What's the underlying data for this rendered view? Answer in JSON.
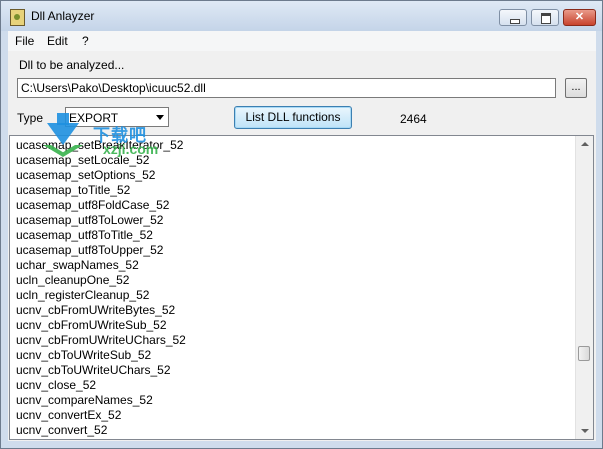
{
  "window": {
    "title": "Dll Anlayzer",
    "close_glyph": "✕"
  },
  "menu": [
    "File",
    "Edit",
    "?"
  ],
  "path_label": "Dll to be analyzed...",
  "path_value": "C:\\Users\\Pako\\Desktop\\icuuc52.dll",
  "browse_label": "...",
  "type_label": "Type",
  "type_value": "EXPORT",
  "list_button_label": "List DLL functions",
  "function_count": "2464",
  "functions": [
    "ucasemap_setBreakIterator_52",
    "ucasemap_setLocale_52",
    "ucasemap_setOptions_52",
    "ucasemap_toTitle_52",
    "ucasemap_utf8FoldCase_52",
    "ucasemap_utf8ToLower_52",
    "ucasemap_utf8ToTitle_52",
    "ucasemap_utf8ToUpper_52",
    "uchar_swapNames_52",
    "ucln_cleanupOne_52",
    "ucln_registerCleanup_52",
    "ucnv_cbFromUWriteBytes_52",
    "ucnv_cbFromUWriteSub_52",
    "ucnv_cbFromUWriteUChars_52",
    "ucnv_cbToUWriteSub_52",
    "ucnv_cbToUWriteUChars_52",
    "ucnv_close_52",
    "ucnv_compareNames_52",
    "ucnv_convertEx_52",
    "ucnv_convert_52"
  ],
  "scroll_position": 0.76,
  "watermark": {
    "text_top": "下载吧",
    "text_bottom": "xzji.com"
  }
}
